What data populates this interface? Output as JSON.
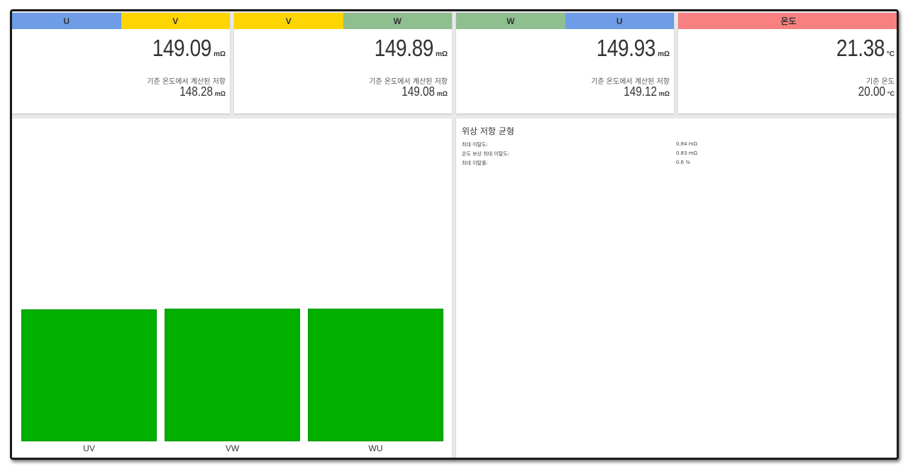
{
  "cards": [
    {
      "headers": [
        {
          "label": "U",
          "color": "#6e9ce6"
        },
        {
          "label": "V",
          "color": "#fdd500"
        }
      ],
      "value": "149.09",
      "unit": "mΩ",
      "ref_label": "기준 온도에서 계산된 저항",
      "ref_value": "148.28",
      "ref_unit": "mΩ"
    },
    {
      "headers": [
        {
          "label": "V",
          "color": "#fdd500"
        },
        {
          "label": "W",
          "color": "#8fbe8f"
        }
      ],
      "value": "149.89",
      "unit": "mΩ",
      "ref_label": "기준 온도에서 계산된 저항",
      "ref_value": "149.08",
      "ref_unit": "mΩ"
    },
    {
      "headers": [
        {
          "label": "W",
          "color": "#8fbe8f"
        },
        {
          "label": "U",
          "color": "#6e9ce6"
        }
      ],
      "value": "149.93",
      "unit": "mΩ",
      "ref_label": "기준 온도에서 계산된 저항",
      "ref_value": "149.12",
      "ref_unit": "mΩ"
    },
    {
      "headers": [
        {
          "label": "온도",
          "color": "#f98080"
        }
      ],
      "value": "21.38",
      "unit": "°C",
      "ref_label": "기준 온도",
      "ref_value": "20.00",
      "ref_unit": "°C"
    }
  ],
  "chart_data": {
    "type": "bar",
    "categories": [
      "UV",
      "VW",
      "WU"
    ],
    "values": [
      149.09,
      149.89,
      149.93
    ],
    "ylim": [
      0,
      340
    ],
    "bar_color": "#00b000"
  },
  "balance": {
    "title": "위상 저항 균형",
    "rows": [
      {
        "label": "최대 이탈도:",
        "value": "0.84 mΩ"
      },
      {
        "label": "온도 보상 최대 이탈도:",
        "value": "0.83 mΩ"
      },
      {
        "label": "최대 이탈률:",
        "value": "0.6 %"
      }
    ]
  }
}
